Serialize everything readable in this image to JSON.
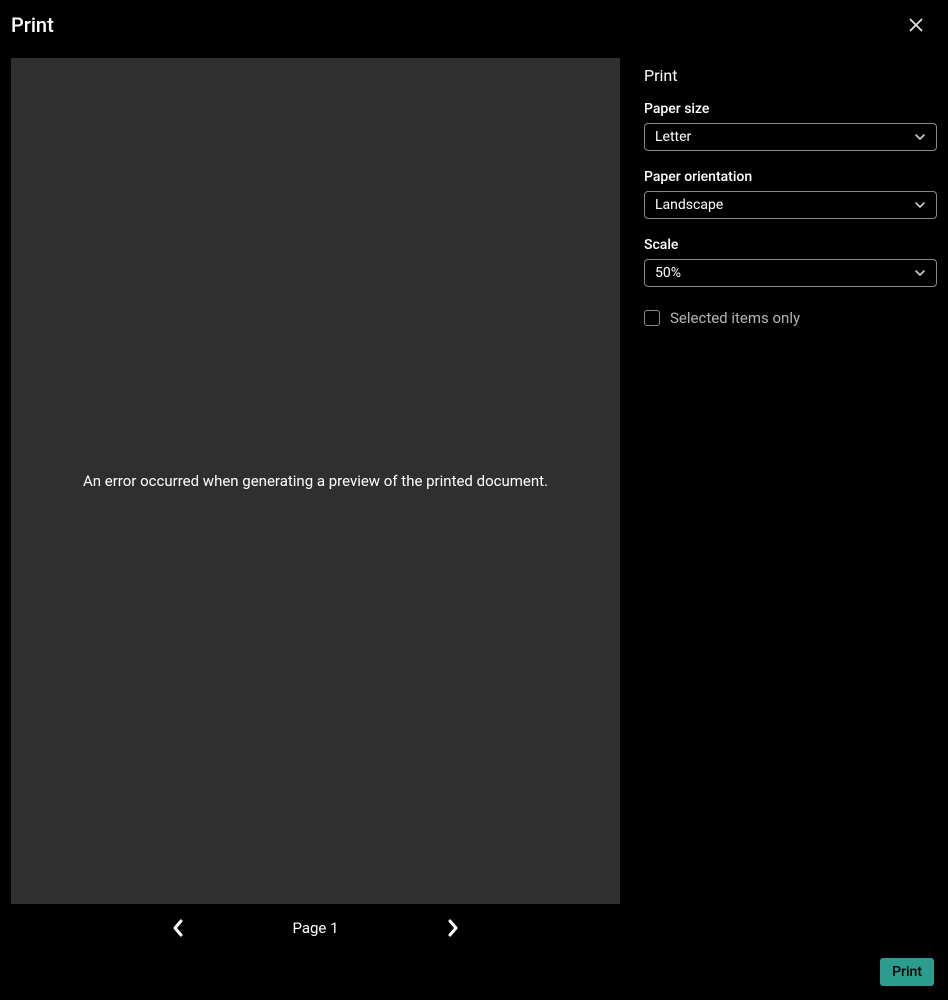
{
  "header": {
    "title": "Print"
  },
  "preview": {
    "error_message": "An error occurred when generating a preview of the printed document.",
    "page_label": "Page 1"
  },
  "settings": {
    "panel_title": "Print",
    "paper_size": {
      "label": "Paper size",
      "value": "Letter"
    },
    "paper_orientation": {
      "label": "Paper orientation",
      "value": "Landscape"
    },
    "scale": {
      "label": "Scale",
      "value": "50%"
    },
    "selected_only": {
      "label": "Selected items only",
      "checked": false
    }
  },
  "footer": {
    "print_button": "Print"
  }
}
